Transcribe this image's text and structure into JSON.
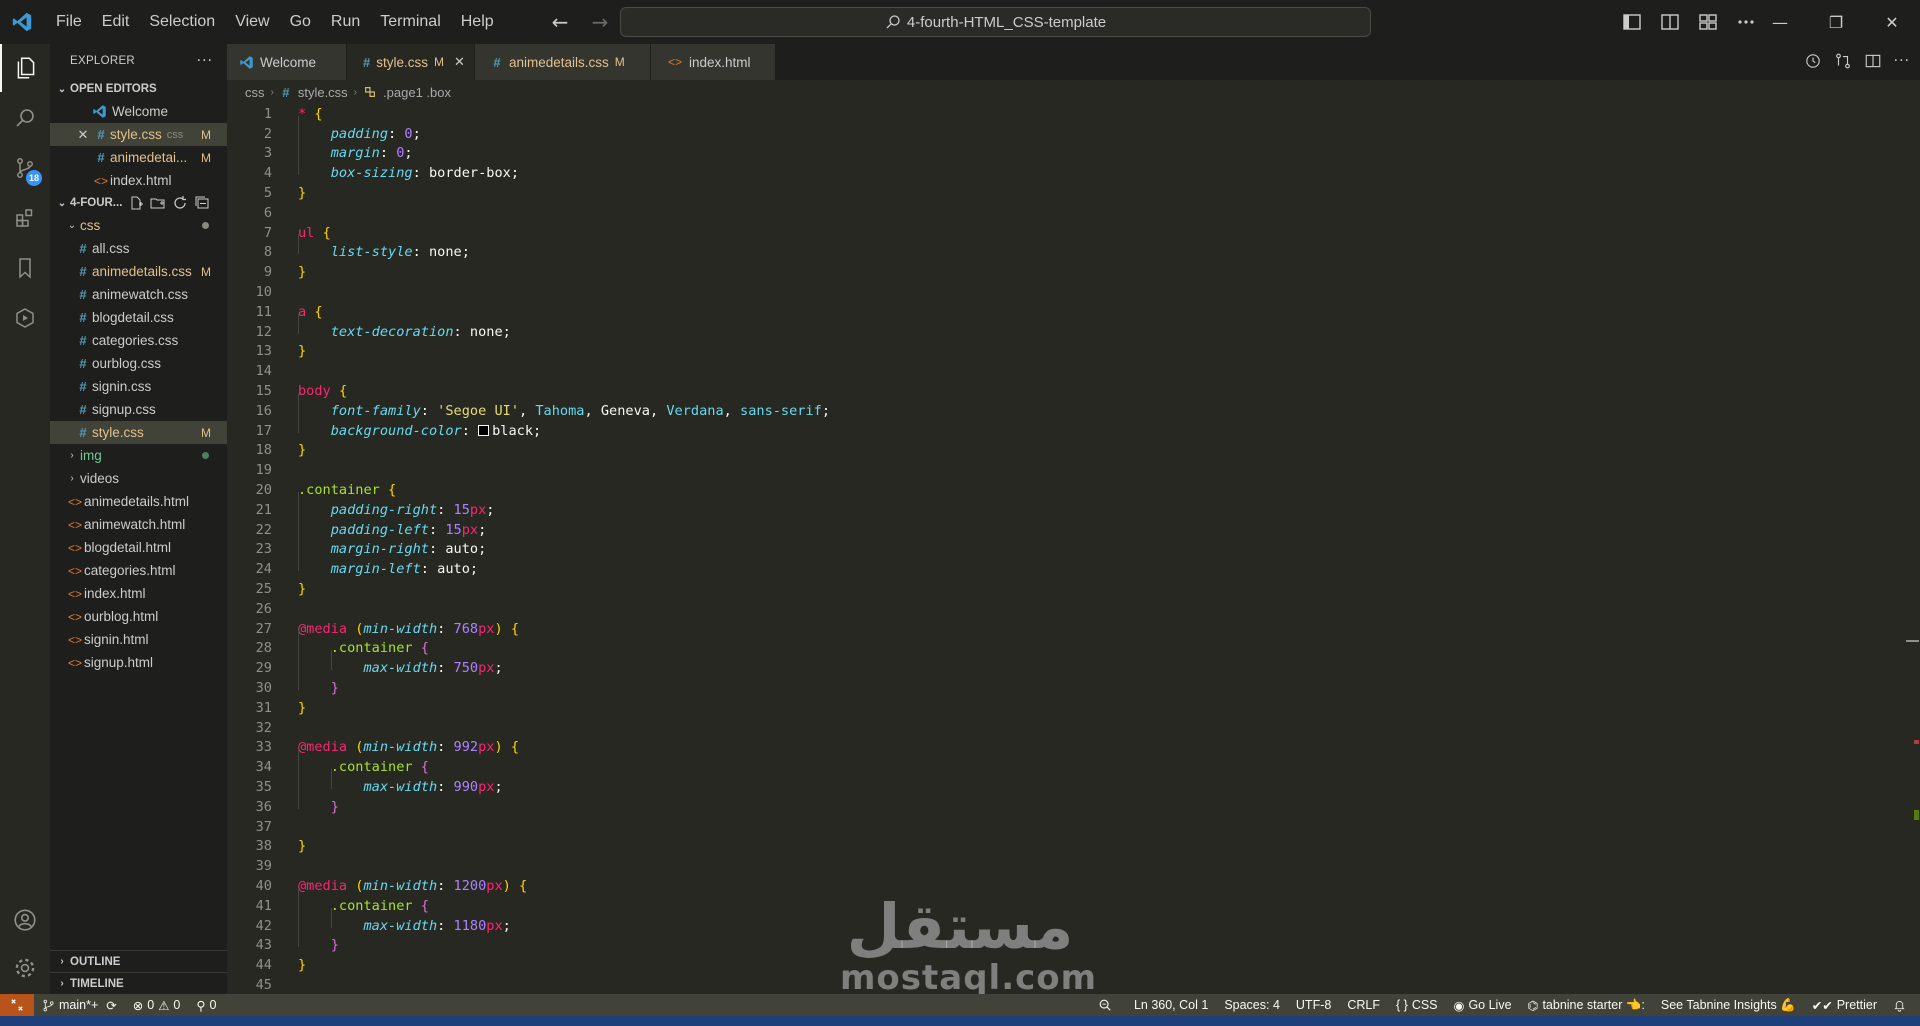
{
  "menu": [
    "File",
    "Edit",
    "Selection",
    "View",
    "Go",
    "Run",
    "Terminal",
    "Help"
  ],
  "command_center": {
    "text": "4-fourth-HTML_CSS-template"
  },
  "sidebar": {
    "title": "EXPLORER",
    "open_editors_label": "OPEN EDITORS",
    "open_editors": [
      {
        "label": "Welcome",
        "icon": "vscode-icon",
        "badge": ""
      },
      {
        "label": "style.css",
        "icon": "css-icon",
        "lang": "css",
        "badge": "M"
      },
      {
        "label": "animedetai...",
        "icon": "css-icon",
        "badge": "M"
      },
      {
        "label": "index.html",
        "icon": "html-icon",
        "badge": ""
      }
    ],
    "folder_label": "4-FOUR...",
    "tree": {
      "css_folder": "css",
      "css_files": [
        {
          "label": "all.css",
          "badge": ""
        },
        {
          "label": "animedetails.css",
          "badge": "M"
        },
        {
          "label": "animewatch.css",
          "badge": ""
        },
        {
          "label": "blogdetail.css",
          "badge": ""
        },
        {
          "label": "categories.css",
          "badge": ""
        },
        {
          "label": "ourblog.css",
          "badge": ""
        },
        {
          "label": "signin.css",
          "badge": ""
        },
        {
          "label": "signup.css",
          "badge": ""
        },
        {
          "label": "style.css",
          "badge": "M"
        }
      ],
      "img_folder": "img",
      "videos_folder": "videos",
      "html_files": [
        "animedetails.html",
        "animewatch.html",
        "blogdetail.html",
        "categories.html",
        "index.html",
        "ourblog.html",
        "signin.html",
        "signup.html"
      ]
    },
    "outline_label": "OUTLINE",
    "timeline_label": "TIMELINE"
  },
  "activity_bar": {
    "source_control_badge": "18"
  },
  "tabs": [
    {
      "label": "Welcome",
      "badge": ""
    },
    {
      "label": "style.css",
      "badge": "M"
    },
    {
      "label": "animedetails.css",
      "badge": "M"
    },
    {
      "label": "index.html",
      "badge": ""
    }
  ],
  "breadcrumbs": [
    "css",
    "style.css",
    ".page1 .box"
  ],
  "code_lines": [
    [
      [
        "kw",
        "*"
      ],
      [
        "p",
        " "
      ],
      [
        "b",
        "{"
      ]
    ],
    [
      [
        "ind",
        ""
      ],
      [
        "prop",
        "padding"
      ],
      [
        "p",
        ": "
      ],
      [
        "num",
        "0"
      ],
      [
        "p",
        ";"
      ]
    ],
    [
      [
        "ind",
        ""
      ],
      [
        "prop",
        "margin"
      ],
      [
        "p",
        ": "
      ],
      [
        "num",
        "0"
      ],
      [
        "p",
        ";"
      ]
    ],
    [
      [
        "ind",
        ""
      ],
      [
        "prop",
        "box-sizing"
      ],
      [
        "p",
        ": "
      ],
      [
        "val",
        "border-box"
      ],
      [
        "p",
        ";"
      ]
    ],
    [
      [
        "b",
        "}"
      ]
    ],
    [],
    [
      [
        "kw",
        "ul"
      ],
      [
        "p",
        " "
      ],
      [
        "b",
        "{"
      ]
    ],
    [
      [
        "ind",
        ""
      ],
      [
        "prop",
        "list-style"
      ],
      [
        "p",
        ": "
      ],
      [
        "val",
        "none"
      ],
      [
        "p",
        ";"
      ]
    ],
    [
      [
        "b",
        "}"
      ]
    ],
    [],
    [
      [
        "kw",
        "a"
      ],
      [
        "p",
        " "
      ],
      [
        "b",
        "{"
      ]
    ],
    [
      [
        "ind",
        ""
      ],
      [
        "prop",
        "text-decoration"
      ],
      [
        "p",
        ": "
      ],
      [
        "val",
        "none"
      ],
      [
        "p",
        ";"
      ]
    ],
    [
      [
        "b",
        "}"
      ]
    ],
    [],
    [
      [
        "kw",
        "body"
      ],
      [
        "p",
        " "
      ],
      [
        "b",
        "{"
      ]
    ],
    [
      [
        "ind",
        ""
      ],
      [
        "prop",
        "font-family"
      ],
      [
        "p",
        ": "
      ],
      [
        "str",
        "'Segoe UI'"
      ],
      [
        "p",
        ", "
      ],
      [
        "fn",
        "Tahoma"
      ],
      [
        "p",
        ", "
      ],
      [
        "val",
        "Geneva"
      ],
      [
        "p",
        ", "
      ],
      [
        "fn",
        "Verdana"
      ],
      [
        "p",
        ", "
      ],
      [
        "fn",
        "sans-serif"
      ],
      [
        "p",
        ";"
      ]
    ],
    [
      [
        "ind",
        ""
      ],
      [
        "prop",
        "background-color"
      ],
      [
        "p",
        ": "
      ],
      [
        "sw",
        ""
      ],
      [
        "val",
        "black"
      ],
      [
        "p",
        ";"
      ]
    ],
    [
      [
        "b",
        "}"
      ]
    ],
    [],
    [
      [
        "sel",
        ".container"
      ],
      [
        "p",
        " "
      ],
      [
        "b",
        "{"
      ]
    ],
    [
      [
        "ind",
        ""
      ],
      [
        "prop",
        "padding-right"
      ],
      [
        "p",
        ": "
      ],
      [
        "num",
        "15"
      ],
      [
        "unit",
        "px"
      ],
      [
        "p",
        ";"
      ]
    ],
    [
      [
        "ind",
        ""
      ],
      [
        "prop",
        "padding-left"
      ],
      [
        "p",
        ": "
      ],
      [
        "num",
        "15"
      ],
      [
        "unit",
        "px"
      ],
      [
        "p",
        ";"
      ]
    ],
    [
      [
        "ind",
        ""
      ],
      [
        "prop",
        "margin-right"
      ],
      [
        "p",
        ": "
      ],
      [
        "val",
        "auto"
      ],
      [
        "p",
        ";"
      ]
    ],
    [
      [
        "ind",
        ""
      ],
      [
        "prop",
        "margin-left"
      ],
      [
        "p",
        ": "
      ],
      [
        "val",
        "auto"
      ],
      [
        "p",
        ";"
      ]
    ],
    [
      [
        "b",
        "}"
      ]
    ],
    [],
    [
      [
        "kw",
        "@media"
      ],
      [
        "p",
        " "
      ],
      [
        "par",
        "("
      ],
      [
        "prop",
        "min-width"
      ],
      [
        "p",
        ": "
      ],
      [
        "num",
        "768"
      ],
      [
        "unit",
        "px"
      ],
      [
        "par",
        ")"
      ],
      [
        "p",
        " "
      ],
      [
        "b",
        "{"
      ]
    ],
    [
      [
        "ind",
        ""
      ],
      [
        "sel",
        ".container"
      ],
      [
        "p",
        " "
      ],
      [
        "b2",
        "{"
      ]
    ],
    [
      [
        "ind",
        ""
      ],
      [
        "ind",
        ""
      ],
      [
        "prop",
        "max-width"
      ],
      [
        "p",
        ": "
      ],
      [
        "num",
        "750"
      ],
      [
        "unit",
        "px"
      ],
      [
        "p",
        ";"
      ]
    ],
    [
      [
        "ind",
        ""
      ],
      [
        "b2",
        "}"
      ]
    ],
    [
      [
        "b",
        "}"
      ]
    ],
    [],
    [
      [
        "kw",
        "@media"
      ],
      [
        "p",
        " "
      ],
      [
        "par",
        "("
      ],
      [
        "prop",
        "min-width"
      ],
      [
        "p",
        ": "
      ],
      [
        "num",
        "992"
      ],
      [
        "unit",
        "px"
      ],
      [
        "par",
        ")"
      ],
      [
        "p",
        " "
      ],
      [
        "b",
        "{"
      ]
    ],
    [
      [
        "ind",
        ""
      ],
      [
        "sel",
        ".container"
      ],
      [
        "p",
        " "
      ],
      [
        "b2",
        "{"
      ]
    ],
    [
      [
        "ind",
        ""
      ],
      [
        "ind",
        ""
      ],
      [
        "prop",
        "max-width"
      ],
      [
        "p",
        ": "
      ],
      [
        "num",
        "990"
      ],
      [
        "unit",
        "px"
      ],
      [
        "p",
        ";"
      ]
    ],
    [
      [
        "ind",
        ""
      ],
      [
        "b2",
        "}"
      ]
    ],
    [],
    [
      [
        "b",
        "}"
      ]
    ],
    [],
    [
      [
        "kw",
        "@media"
      ],
      [
        "p",
        " "
      ],
      [
        "par",
        "("
      ],
      [
        "prop",
        "min-width"
      ],
      [
        "p",
        ": "
      ],
      [
        "num",
        "1200"
      ],
      [
        "unit",
        "px"
      ],
      [
        "par",
        ")"
      ],
      [
        "p",
        " "
      ],
      [
        "b",
        "{"
      ]
    ],
    [
      [
        "ind",
        ""
      ],
      [
        "sel",
        ".container"
      ],
      [
        "p",
        " "
      ],
      [
        "b2",
        "{"
      ]
    ],
    [
      [
        "ind",
        ""
      ],
      [
        "ind",
        ""
      ],
      [
        "prop",
        "max-width"
      ],
      [
        "p",
        ": "
      ],
      [
        "num",
        "1180"
      ],
      [
        "unit",
        "px"
      ],
      [
        "p",
        ";"
      ]
    ],
    [
      [
        "ind",
        ""
      ],
      [
        "b2",
        "}"
      ]
    ],
    [
      [
        "b",
        "}"
      ]
    ],
    []
  ],
  "watermark": {
    "arabic": "مستقل",
    "latin": "mostaql.com"
  },
  "status": {
    "branch": "main*+",
    "errors": "0",
    "warnings": "0",
    "ports": "0",
    "position": "Ln 360, Col 1",
    "spaces": "Spaces: 4",
    "encoding": "UTF-8",
    "eol": "CRLF",
    "language": "CSS",
    "golive": "Go Live",
    "tabnine": "tabnine starter 👈:",
    "tabnine_insights": "See Tabnine Insights 💪",
    "prettier": "Prettier"
  },
  "colors": {
    "accent_modified": "#e2c08d",
    "remote_button": "#b8541a",
    "badge_blue": "#3794ff"
  }
}
